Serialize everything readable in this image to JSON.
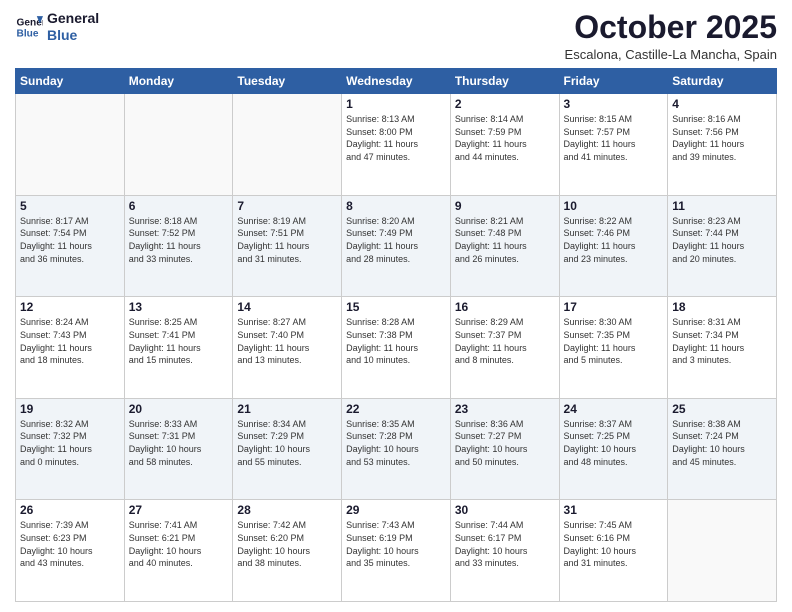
{
  "logo": {
    "line1": "General",
    "line2": "Blue"
  },
  "header": {
    "month": "October 2025",
    "location": "Escalona, Castille-La Mancha, Spain"
  },
  "days_of_week": [
    "Sunday",
    "Monday",
    "Tuesday",
    "Wednesday",
    "Thursday",
    "Friday",
    "Saturday"
  ],
  "weeks": [
    [
      {
        "day": "",
        "info": ""
      },
      {
        "day": "",
        "info": ""
      },
      {
        "day": "",
        "info": ""
      },
      {
        "day": "1",
        "info": "Sunrise: 8:13 AM\nSunset: 8:00 PM\nDaylight: 11 hours\nand 47 minutes."
      },
      {
        "day": "2",
        "info": "Sunrise: 8:14 AM\nSunset: 7:59 PM\nDaylight: 11 hours\nand 44 minutes."
      },
      {
        "day": "3",
        "info": "Sunrise: 8:15 AM\nSunset: 7:57 PM\nDaylight: 11 hours\nand 41 minutes."
      },
      {
        "day": "4",
        "info": "Sunrise: 8:16 AM\nSunset: 7:56 PM\nDaylight: 11 hours\nand 39 minutes."
      }
    ],
    [
      {
        "day": "5",
        "info": "Sunrise: 8:17 AM\nSunset: 7:54 PM\nDaylight: 11 hours\nand 36 minutes."
      },
      {
        "day": "6",
        "info": "Sunrise: 8:18 AM\nSunset: 7:52 PM\nDaylight: 11 hours\nand 33 minutes."
      },
      {
        "day": "7",
        "info": "Sunrise: 8:19 AM\nSunset: 7:51 PM\nDaylight: 11 hours\nand 31 minutes."
      },
      {
        "day": "8",
        "info": "Sunrise: 8:20 AM\nSunset: 7:49 PM\nDaylight: 11 hours\nand 28 minutes."
      },
      {
        "day": "9",
        "info": "Sunrise: 8:21 AM\nSunset: 7:48 PM\nDaylight: 11 hours\nand 26 minutes."
      },
      {
        "day": "10",
        "info": "Sunrise: 8:22 AM\nSunset: 7:46 PM\nDaylight: 11 hours\nand 23 minutes."
      },
      {
        "day": "11",
        "info": "Sunrise: 8:23 AM\nSunset: 7:44 PM\nDaylight: 11 hours\nand 20 minutes."
      }
    ],
    [
      {
        "day": "12",
        "info": "Sunrise: 8:24 AM\nSunset: 7:43 PM\nDaylight: 11 hours\nand 18 minutes."
      },
      {
        "day": "13",
        "info": "Sunrise: 8:25 AM\nSunset: 7:41 PM\nDaylight: 11 hours\nand 15 minutes."
      },
      {
        "day": "14",
        "info": "Sunrise: 8:27 AM\nSunset: 7:40 PM\nDaylight: 11 hours\nand 13 minutes."
      },
      {
        "day": "15",
        "info": "Sunrise: 8:28 AM\nSunset: 7:38 PM\nDaylight: 11 hours\nand 10 minutes."
      },
      {
        "day": "16",
        "info": "Sunrise: 8:29 AM\nSunset: 7:37 PM\nDaylight: 11 hours\nand 8 minutes."
      },
      {
        "day": "17",
        "info": "Sunrise: 8:30 AM\nSunset: 7:35 PM\nDaylight: 11 hours\nand 5 minutes."
      },
      {
        "day": "18",
        "info": "Sunrise: 8:31 AM\nSunset: 7:34 PM\nDaylight: 11 hours\nand 3 minutes."
      }
    ],
    [
      {
        "day": "19",
        "info": "Sunrise: 8:32 AM\nSunset: 7:32 PM\nDaylight: 11 hours\nand 0 minutes."
      },
      {
        "day": "20",
        "info": "Sunrise: 8:33 AM\nSunset: 7:31 PM\nDaylight: 10 hours\nand 58 minutes."
      },
      {
        "day": "21",
        "info": "Sunrise: 8:34 AM\nSunset: 7:29 PM\nDaylight: 10 hours\nand 55 minutes."
      },
      {
        "day": "22",
        "info": "Sunrise: 8:35 AM\nSunset: 7:28 PM\nDaylight: 10 hours\nand 53 minutes."
      },
      {
        "day": "23",
        "info": "Sunrise: 8:36 AM\nSunset: 7:27 PM\nDaylight: 10 hours\nand 50 minutes."
      },
      {
        "day": "24",
        "info": "Sunrise: 8:37 AM\nSunset: 7:25 PM\nDaylight: 10 hours\nand 48 minutes."
      },
      {
        "day": "25",
        "info": "Sunrise: 8:38 AM\nSunset: 7:24 PM\nDaylight: 10 hours\nand 45 minutes."
      }
    ],
    [
      {
        "day": "26",
        "info": "Sunrise: 7:39 AM\nSunset: 6:23 PM\nDaylight: 10 hours\nand 43 minutes."
      },
      {
        "day": "27",
        "info": "Sunrise: 7:41 AM\nSunset: 6:21 PM\nDaylight: 10 hours\nand 40 minutes."
      },
      {
        "day": "28",
        "info": "Sunrise: 7:42 AM\nSunset: 6:20 PM\nDaylight: 10 hours\nand 38 minutes."
      },
      {
        "day": "29",
        "info": "Sunrise: 7:43 AM\nSunset: 6:19 PM\nDaylight: 10 hours\nand 35 minutes."
      },
      {
        "day": "30",
        "info": "Sunrise: 7:44 AM\nSunset: 6:17 PM\nDaylight: 10 hours\nand 33 minutes."
      },
      {
        "day": "31",
        "info": "Sunrise: 7:45 AM\nSunset: 6:16 PM\nDaylight: 10 hours\nand 31 minutes."
      },
      {
        "day": "",
        "info": ""
      }
    ]
  ]
}
